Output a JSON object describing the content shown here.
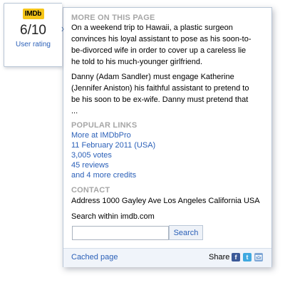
{
  "badge": {
    "logo_text": "IMDb",
    "rating": "6/10",
    "rating_label": "User rating"
  },
  "more": {
    "heading": "MORE ON THIS PAGE",
    "summary_lines": [
      "On a weekend trip to Hawaii, a plastic surgeon",
      "convinces his loyal assistant to pose as his soon-to-",
      "be-divorced wife in order to cover up a careless lie",
      "he told to his much-younger girlfriend."
    ],
    "cast_lines": [
      "Danny (Adam Sandler) must engage Katherine",
      "(Jennifer Aniston) his faithful assistant to pretend to",
      "be his soon to be ex-wife. Danny must pretend that",
      "..."
    ]
  },
  "popular": {
    "heading": "POPULAR LINKS",
    "links": [
      "More at IMDbPro",
      "11 February 2011 (USA)",
      "3,005 votes",
      "45 reviews",
      "and 4 more credits"
    ]
  },
  "contact": {
    "heading": "CONTACT",
    "address": "Address 1000 Gayley Ave Los Angeles California USA"
  },
  "search": {
    "label": "Search within imdb.com",
    "value": "",
    "button": "Search"
  },
  "footer": {
    "cached": "Cached page",
    "share": "Share",
    "icons": [
      "facebook-icon",
      "twitter-icon",
      "email-icon"
    ]
  },
  "colors": {
    "accent": "#2b60b8",
    "logo": "#f5c518",
    "border": "#b9c6d6",
    "footer_bg": "#f0f4fa"
  }
}
